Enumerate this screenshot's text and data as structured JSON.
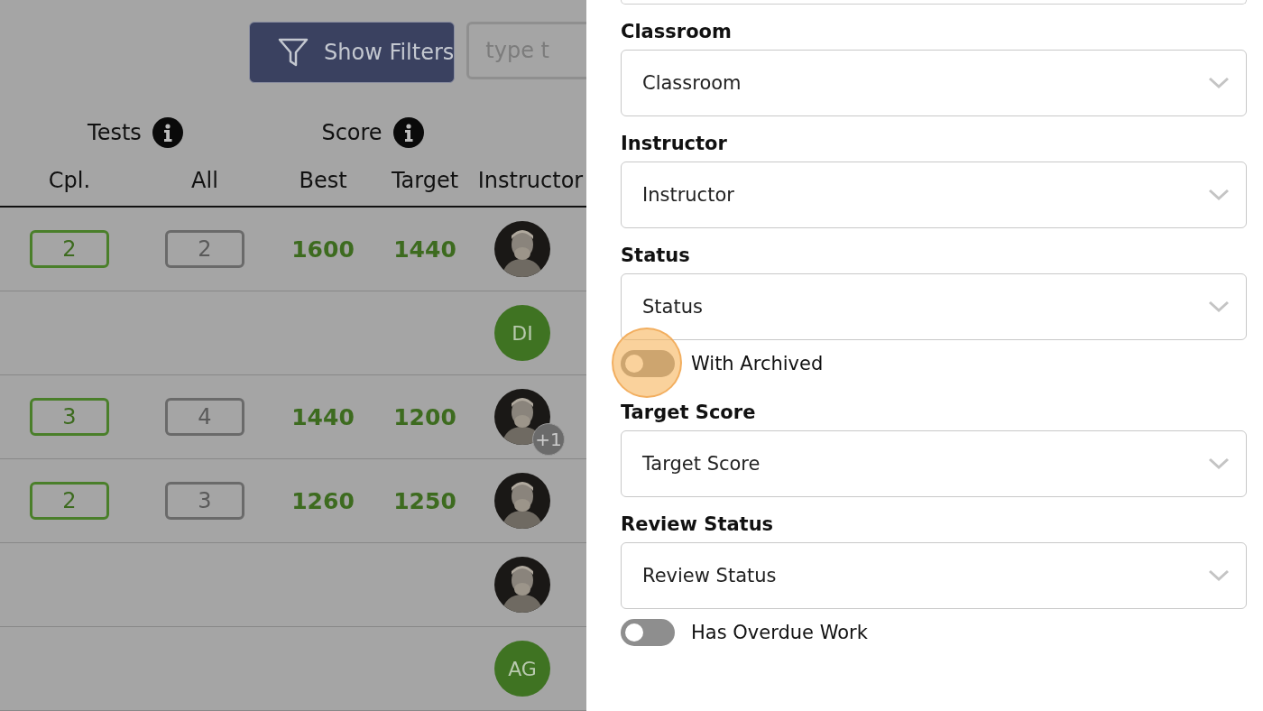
{
  "toolbar": {
    "filter_button": "Show Filters",
    "search": {
      "placeholder": "type t"
    }
  },
  "table": {
    "groups": [
      {
        "label": "Tests"
      },
      {
        "label": "Score"
      }
    ],
    "columns": [
      "Cpl.",
      "All",
      "Best",
      "Target",
      "Instructor"
    ],
    "rows": [
      {
        "completed": "2",
        "all": "2",
        "best": "1600",
        "target": "1440",
        "instructor": {
          "kind": "picture"
        }
      },
      {
        "instructor": {
          "kind": "initials",
          "initials": "DI"
        }
      },
      {
        "completed": "3",
        "all": "4",
        "best": "1440",
        "target": "1200",
        "instructor": {
          "kind": "picture",
          "extra": "+1"
        }
      },
      {
        "completed": "2",
        "all": "3",
        "best": "1260",
        "target": "1250",
        "instructor": {
          "kind": "picture"
        }
      },
      {
        "instructor": {
          "kind": "picture"
        }
      },
      {
        "instructor": {
          "kind": "initials",
          "initials": "AG"
        }
      }
    ]
  },
  "filters": [
    {
      "kind": "select",
      "label": "Classroom",
      "value": "Classroom"
    },
    {
      "kind": "select",
      "label": "Instructor",
      "value": "Instructor"
    },
    {
      "kind": "select",
      "label": "Status",
      "value": "Status"
    },
    {
      "kind": "toggle",
      "label": "With Archived",
      "on": false,
      "highlighted": true
    },
    {
      "kind": "select",
      "label": "Target Score",
      "value": "Target Score"
    },
    {
      "kind": "select",
      "label": "Review Status",
      "value": "Review Status"
    },
    {
      "kind": "toggle",
      "label": "Has Overdue Work",
      "on": false,
      "highlighted": false
    }
  ]
}
